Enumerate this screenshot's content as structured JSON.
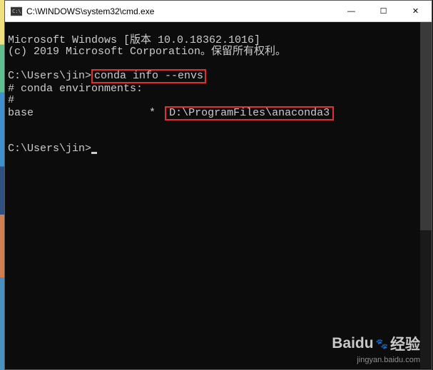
{
  "titlebar": {
    "icon_label": "cmd-icon",
    "title": "C:\\WINDOWS\\system32\\cmd.exe",
    "minimize": "—",
    "maximize": "☐",
    "close": "✕"
  },
  "terminal": {
    "line1": "Microsoft Windows [版本 10.0.18362.1016]",
    "line2": "(c) 2019 Microsoft Corporation。保留所有权利。",
    "prompt1_prefix": "C:\\Users\\jin>",
    "prompt1_command": "conda info --envs",
    "env_header": "# conda environments:",
    "env_hash": "#",
    "env_base_label": "base",
    "env_base_star": "*",
    "env_base_path": "D:\\ProgramFiles\\anaconda3",
    "prompt2": "C:\\Users\\jin>"
  },
  "watermark": {
    "brand": "Baidu",
    "brand_cn": "经验",
    "url": "jingyan.baidu.com"
  }
}
